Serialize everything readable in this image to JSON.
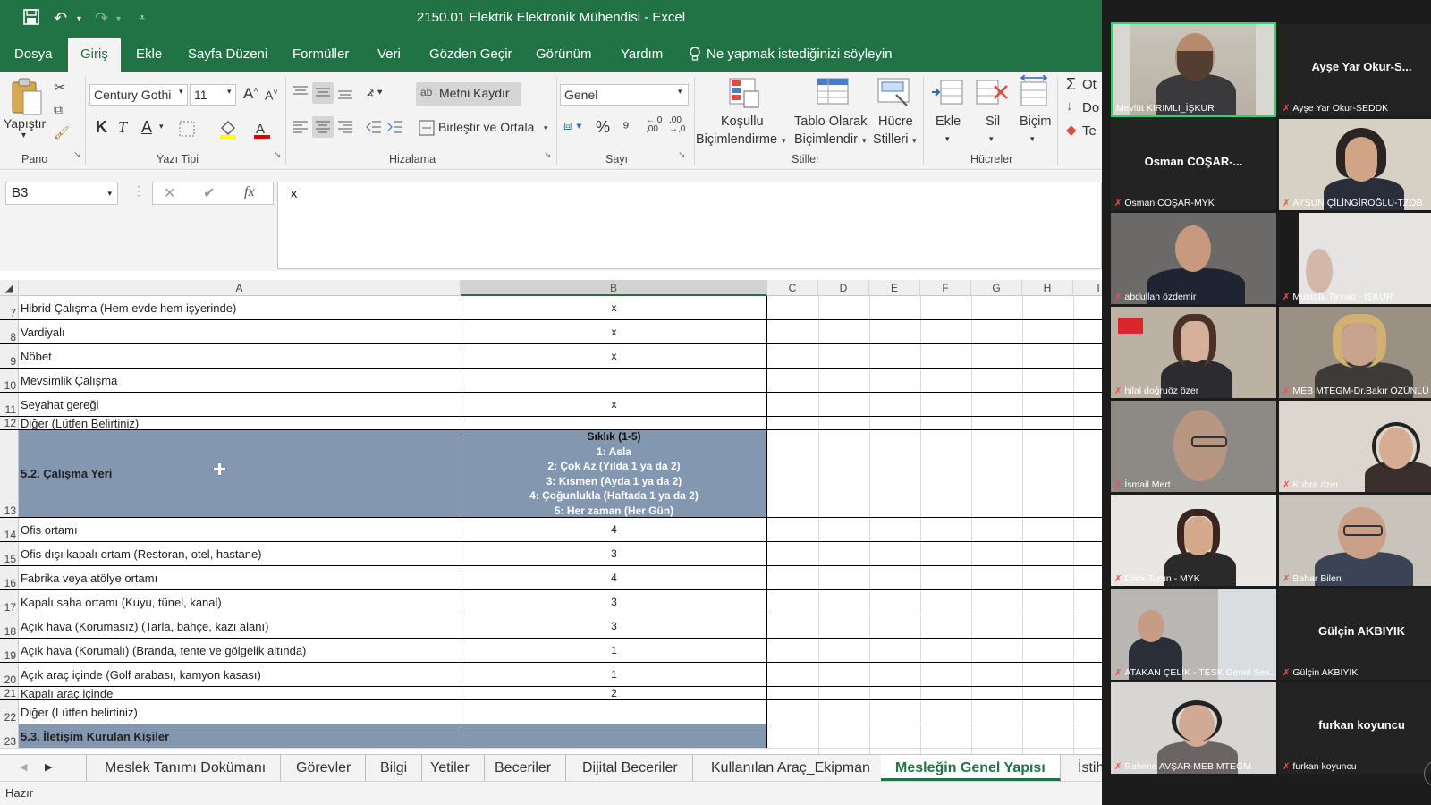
{
  "window": {
    "title": "2150.01 Elektrik Elektronik Mühendisi  -  Excel"
  },
  "menu": {
    "items": [
      "Dosya",
      "Giriş",
      "Ekle",
      "Sayfa Düzeni",
      "Formüller",
      "Veri",
      "Gözden Geçir",
      "Görünüm",
      "Yardım"
    ],
    "active_index": 1,
    "tell_me": "Ne yapmak istediğinizi söyleyin"
  },
  "ribbon": {
    "paste_label": "Yapıştır",
    "font_name": "Century Gothi",
    "font_size": "11",
    "bold": "K",
    "italic": "T",
    "underline": "A",
    "wrap_text": "Metni Kaydır",
    "merge_center": "Birleştir ve Ortala",
    "number_format": "Genel",
    "conditional_formatting_1": "Koşullu",
    "conditional_formatting_2": "Biçimlendirme",
    "format_table_1": "Tablo Olarak",
    "format_table_2": "Biçimlendir",
    "cell_styles_1": "Hücre",
    "cell_styles_2": "Stilleri",
    "insert": "Ekle",
    "delete": "Sil",
    "format": "Biçim",
    "autosum": "Ot",
    "fill": "Do",
    "clear": "Te",
    "groups": {
      "clipboard": "Pano",
      "font": "Yazı Tipi",
      "alignment": "Hizalama",
      "number": "Sayı",
      "styles": "Stiller",
      "cells": "Hücreler"
    },
    "percent": "%",
    "comma": "⁹",
    "inc_decimal": "←,0 ,00",
    "dec_decimal": ",00 →,0"
  },
  "formula_bar": {
    "name_box": "B3",
    "fx": "fx",
    "content": "x"
  },
  "columns": [
    "A",
    "B",
    "C",
    "D",
    "E",
    "F",
    "G",
    "H",
    "I"
  ],
  "rows": [
    {
      "num": "7",
      "a": "Hibrid Çalışma (Hem evde hem işyerinde)",
      "b": "x"
    },
    {
      "num": "8",
      "a": "Vardiyalı",
      "b": "x"
    },
    {
      "num": "9",
      "a": "Nöbet",
      "b": "x"
    },
    {
      "num": "10",
      "a": "Mevsimlik Çalışma",
      "b": ""
    },
    {
      "num": "11",
      "a": "Seyahat gereği",
      "b": "x"
    },
    {
      "num": "12",
      "a": "Diğer (Lütfen Belirtiniz)",
      "b": ""
    },
    {
      "num": "13",
      "a": "5.2. Çalışma Yeri",
      "b_lines": [
        "Sıklık (1-5)",
        "1: Asla",
        "2: Çok Az (Yılda 1 ya da 2)",
        "3: Kısmen (Ayda 1 ya da 2)",
        "4: Çoğunlukla (Haftada 1 ya da 2)",
        "5: Her zaman (Her Gün)"
      ]
    },
    {
      "num": "14",
      "a": "Ofis ortamı",
      "b": "4"
    },
    {
      "num": "15",
      "a": "Ofis dışı kapalı ortam (Restoran, otel, hastane)",
      "b": "3"
    },
    {
      "num": "16",
      "a": "Fabrika veya atölye ortamı",
      "b": "4"
    },
    {
      "num": "17",
      "a": "Kapalı saha ortamı (Kuyu, tünel, kanal)",
      "b": "3"
    },
    {
      "num": "18",
      "a": "Açık hava (Korumasız) (Tarla, bahçe, kazı alanı)",
      "b": "3"
    },
    {
      "num": "19",
      "a": "Açık hava (Korumalı) (Branda, tente ve gölgelik altında)",
      "b": "1"
    },
    {
      "num": "20",
      "a": "Açık araç içinde (Golf arabası, kamyon kasası)",
      "b": "1"
    },
    {
      "num": "21",
      "a": "Kapalı araç içinde",
      "b": "2"
    },
    {
      "num": "22",
      "a": "Diğer (Lütfen belirtiniz)",
      "b": ""
    },
    {
      "num": "23",
      "a": "5.3. İletişim Kurulan Kişiler",
      "b": ""
    }
  ],
  "sheet_tabs": [
    "Meslek Tanımı Dokümanı",
    "Görevler",
    "Bilgi",
    "Yetiler",
    "Beceriler",
    "Dijital Beceriler",
    "Kullanılan Araç_Ekipman",
    "Mesleğin Genel Yapısı",
    "İstih"
  ],
  "active_tab_index": 7,
  "status": "Hazır",
  "colors": {
    "excel_green": "#217346",
    "header_fill": "#8497b0"
  },
  "participants": [
    {
      "label": "Mevlüt KIRIMLI_İŞKUR",
      "center": "",
      "active": true
    },
    {
      "label": "Ayşe Yar Okur-SEDDK",
      "center": "Ayşe Yar Okur-S..."
    },
    {
      "label": "Osman COŞAR-MYK",
      "center": "Osman  COŞAR-..."
    },
    {
      "label": "AYSUN ÇİLİNGİROĞLU-TZOB",
      "center": ""
    },
    {
      "label": "abdullah özdemir",
      "center": ""
    },
    {
      "label": "Mustafa Tiryaki - İŞKUR",
      "center": ""
    },
    {
      "label": "hilal doğruöz özer",
      "center": ""
    },
    {
      "label": "MEB MTEGM-Dr.Bakır ÖZÜNLÜ",
      "center": ""
    },
    {
      "label": "İsmail Mert",
      "center": ""
    },
    {
      "label": "Kübra özer",
      "center": ""
    },
    {
      "label": "Dilek Torun - MYK",
      "center": ""
    },
    {
      "label": "Bahar Bilen",
      "center": ""
    },
    {
      "label": "ATAKAN ÇELİK - TESK Genel Sek...",
      "center": ""
    },
    {
      "label": "Gülçin AKBIYIK",
      "center": "Gülçin AKBIYIK"
    },
    {
      "label": "Rahime AVŞAR-MEB MTEGM",
      "center": ""
    },
    {
      "label": "furkan koyuncu",
      "center": "furkan koyuncu"
    }
  ]
}
